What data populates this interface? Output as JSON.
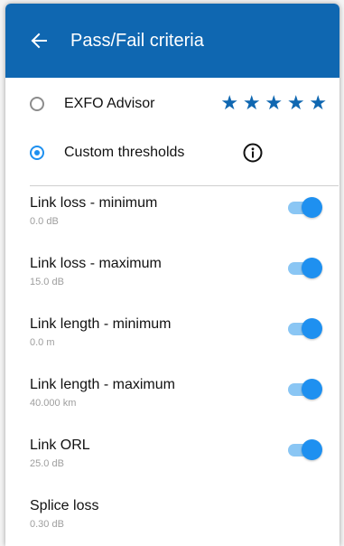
{
  "header": {
    "title": "Pass/Fail criteria"
  },
  "criteria": {
    "advisor_label": "EXFO Advisor",
    "advisor_rating": 5,
    "custom_label": "Custom thresholds",
    "selected": "custom"
  },
  "settings": [
    {
      "label": "Link loss - minimum",
      "value": "0.0 dB",
      "enabled": true
    },
    {
      "label": "Link loss - maximum",
      "value": "15.0 dB",
      "enabled": true
    },
    {
      "label": "Link length - minimum",
      "value": "0.0 m",
      "enabled": true
    },
    {
      "label": "Link length - maximum",
      "value": "40.000 km",
      "enabled": true
    },
    {
      "label": "Link ORL",
      "value": "25.0 dB",
      "enabled": true
    },
    {
      "label": "Splice loss",
      "value": "0.30 dB"
    }
  ],
  "colors": {
    "appbar": "#0f67b1",
    "accent": "#1e90f0",
    "track": "#8ac6f4"
  },
  "icons": {
    "back": "arrow-left-icon",
    "info": "info-icon",
    "rating": "star-icon"
  }
}
